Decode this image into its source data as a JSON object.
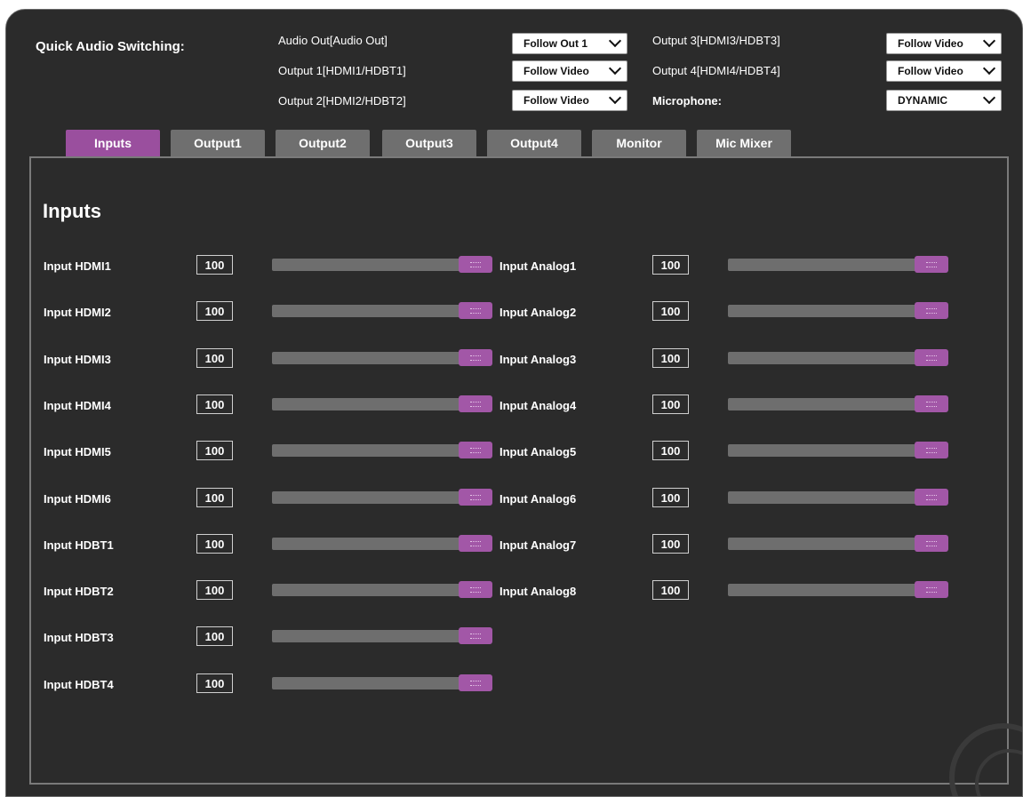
{
  "quick_audio": {
    "title": "Quick Audio Switching:",
    "rows": [
      {
        "label": "Audio Out[Audio Out]",
        "value": "Follow Out 1"
      },
      {
        "label": "Output 1[HDMI1/HDBT1]",
        "value": "Follow Video"
      },
      {
        "label": "Output 2[HDMI2/HDBT2]",
        "value": "Follow Video"
      },
      {
        "label": "Output 3[HDMI3/HDBT3]",
        "value": "Follow Video"
      },
      {
        "label": "Output 4[HDMI4/HDBT4]",
        "value": "Follow Video"
      },
      {
        "label": "Microphone:",
        "value": "DYNAMIC"
      }
    ]
  },
  "tabs": [
    "Inputs",
    "Output1",
    "Output2",
    "Output3",
    "Output4",
    "Monitor",
    "Mic Mixer"
  ],
  "active_tab": "Inputs",
  "panel_title": "Inputs",
  "left_inputs": [
    {
      "label": "Input HDMI1",
      "value": "100",
      "level": 1.0
    },
    {
      "label": "Input HDMI2",
      "value": "100",
      "level": 1.0
    },
    {
      "label": "Input HDMI3",
      "value": "100",
      "level": 1.0
    },
    {
      "label": "Input HDMI4",
      "value": "100",
      "level": 1.0
    },
    {
      "label": "Input HDMI5",
      "value": "100",
      "level": 1.0
    },
    {
      "label": "Input HDMI6",
      "value": "100",
      "level": 1.0
    },
    {
      "label": "Input HDBT1",
      "value": "100",
      "level": 1.0
    },
    {
      "label": "Input HDBT2",
      "value": "100",
      "level": 1.0
    },
    {
      "label": "Input HDBT3",
      "value": "100",
      "level": 1.0
    },
    {
      "label": "Input HDBT4",
      "value": "100",
      "level": 1.0
    }
  ],
  "right_inputs": [
    {
      "label": "Input Analog1",
      "value": "100",
      "level": 1.0
    },
    {
      "label": "Input Analog2",
      "value": "100",
      "level": 1.0
    },
    {
      "label": "Input Analog3",
      "value": "100",
      "level": 1.0
    },
    {
      "label": "Input Analog4",
      "value": "100",
      "level": 1.0
    },
    {
      "label": "Input Analog5",
      "value": "100",
      "level": 1.0
    },
    {
      "label": "Input Analog6",
      "value": "100",
      "level": 1.0
    },
    {
      "label": "Input Analog7",
      "value": "100",
      "level": 1.0
    },
    {
      "label": "Input Analog8",
      "value": "100",
      "level": 1.0
    }
  ],
  "colors": {
    "background": "#2b2b2b",
    "accent": "#9a4f9e",
    "tab_inactive": "#6f6f6f",
    "slider_track": "#6e6e6e"
  }
}
